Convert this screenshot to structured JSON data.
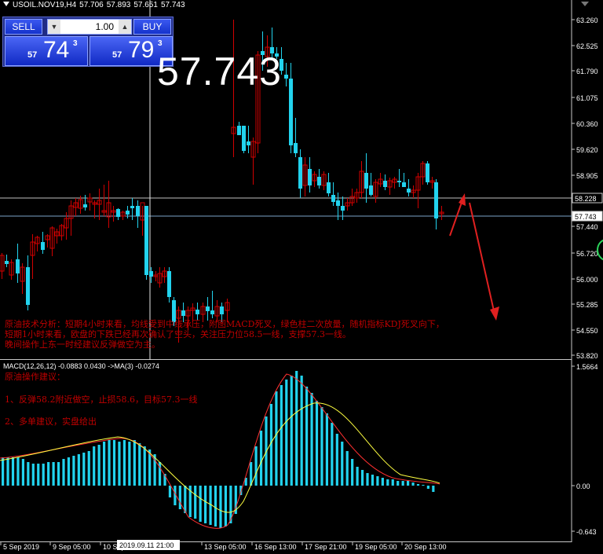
{
  "header": {
    "symbol": "USOIL.NOV19,H4",
    "open": "57.706",
    "high": "57.893",
    "low": "57.651",
    "close": "57.743"
  },
  "trade_panel": {
    "sell_label": "SELL",
    "buy_label": "BUY",
    "lot": "1.00",
    "sell_price_prefix": "57",
    "sell_price_big": "74",
    "sell_price_sup": "3",
    "buy_price_prefix": "57",
    "buy_price_big": "79",
    "buy_price_sup": "3"
  },
  "big_price": "57.743",
  "price_axis": {
    "ticks": [
      "63.260",
      "62.525",
      "61.790",
      "61.075",
      "60.360",
      "59.620",
      "58.905",
      "57.440",
      "56.720",
      "56.000",
      "55.285",
      "54.550",
      "53.820"
    ],
    "marker_upper": "58.228",
    "marker_current": "57.743"
  },
  "macd": {
    "label": "MACD(12,26,12) -0.0883 0.0430 ->MA(3) -0.0274",
    "axis_ticks": [
      "1.5664",
      "0.00",
      "-0.643"
    ]
  },
  "time_axis": {
    "labels": [
      "5 Sep 2019",
      "9 Sep 05:00",
      "10 Sep",
      "13 Sep 05:00",
      "16 Sep 13:00",
      "17 Sep 21:00",
      "19 Sep 05:00",
      "20 Sep 13:00"
    ],
    "crosshair_label": "2019.09.11 21:00"
  },
  "analysis": {
    "line1": "原油技术分析：短期4小时来看，均线受到中线承压，附图MACD死叉，绿色柱二次放量，随机指标KDJ死叉向下，",
    "line2": "短期1小时来看，欧盘的下跌已经再次确认了空头，关注压力位58.5一线，支撑57.3一线。",
    "line3": "晚间操作上东一时经建议反弹做空为主。",
    "advice_title": "原油操作建议：",
    "advice1": "1、反弹58.2附近做空，止损58.6，目标57.3一线",
    "advice2": "2、多单建议，实盘给出"
  },
  "colors": {
    "up_candle": "#d00000",
    "down_candle": "#22d3ee",
    "macd_hist": "#22d3ee",
    "macd_line": "#ff3030",
    "signal_line": "#ffff40",
    "text_red": "#c00000",
    "panel_blue": "#1f2b86"
  }
}
